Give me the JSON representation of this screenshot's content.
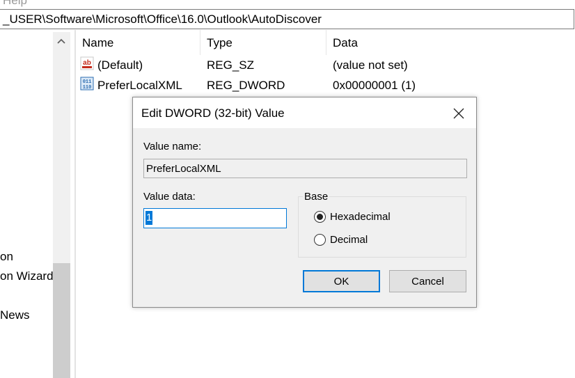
{
  "menu": {
    "help_label": "Help"
  },
  "address": {
    "path": "_USER\\Software\\Microsoft\\Office\\16.0\\Outlook\\AutoDiscover"
  },
  "tree": {
    "items": [
      "on",
      "on Wizard",
      "News"
    ]
  },
  "list": {
    "columns": [
      "Name",
      "Type",
      "Data"
    ],
    "rows": [
      {
        "name": "(Default)",
        "type": "REG_SZ",
        "data": "(value not set)",
        "icon": "string-value-icon"
      },
      {
        "name": "PreferLocalXML",
        "type": "REG_DWORD",
        "data": "0x00000001 (1)",
        "icon": "binary-value-icon"
      }
    ]
  },
  "dialog": {
    "title": "Edit DWORD (32-bit) Value",
    "value_name_label": "Value name:",
    "value_name": "PreferLocalXML",
    "value_data_label": "Value data:",
    "value_data": "1",
    "base_label": "Base",
    "options": [
      "Hexadecimal",
      "Decimal"
    ],
    "selected_option": "Hexadecimal",
    "ok_label": "OK",
    "cancel_label": "Cancel"
  },
  "colors": {
    "accent": "#0078d7",
    "dialog_bg": "#f0f0f0",
    "icon_red": "#c42b1c",
    "icon_blue": "#2b6cb0"
  }
}
